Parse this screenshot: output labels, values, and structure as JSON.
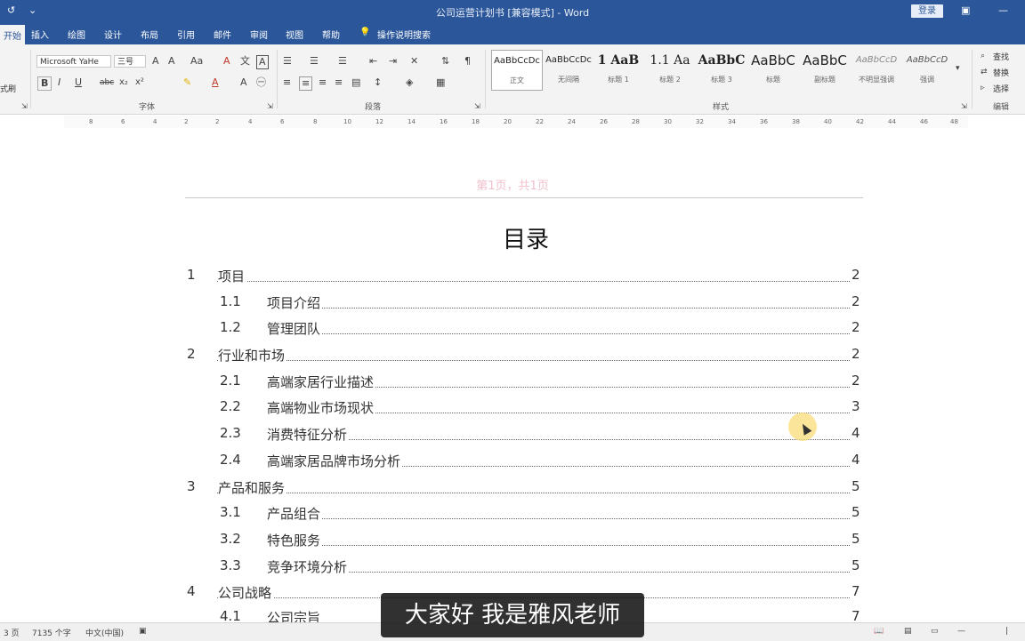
{
  "window": {
    "title": "公司运营计划书 [兼容模式]  -  Word",
    "login": "登录",
    "ribbon_display_icon": "ribbon-display-icon",
    "minimize_icon": "minimize-icon"
  },
  "tabs": [
    "开始",
    "插入",
    "绘图",
    "设计",
    "布局",
    "引用",
    "邮件",
    "审阅",
    "视图",
    "帮助"
  ],
  "tell_me": "操作说明搜索",
  "ribbon": {
    "clipboard": {
      "format_painter": "式刷"
    },
    "font": {
      "font_name": "Microsoft YaHe",
      "font_size": "三号",
      "group_label": "字体",
      "bold": "B",
      "italic": "I",
      "underline": "U",
      "strike": "abc",
      "subscript": "x₂",
      "superscript": "x²",
      "grow": "A",
      "shrink": "A",
      "case": "Aa",
      "clear": "A",
      "phonetic": "文",
      "border": "A"
    },
    "paragraph": {
      "group_label": "段落"
    },
    "styles": {
      "group_label": "样式",
      "items": [
        {
          "sample": "AaBbCcDc",
          "name": "正文"
        },
        {
          "sample": "AaBbCcDc",
          "name": "无间隔"
        },
        {
          "sample": "1  AaB",
          "name": "标题 1"
        },
        {
          "sample": "1.1  Aa",
          "name": "标题 2"
        },
        {
          "sample": "AaBbC",
          "name": "标题 3"
        },
        {
          "sample": "AaBbC",
          "name": "标题"
        },
        {
          "sample": "AaBbC",
          "name": "副标题"
        },
        {
          "sample": "AaBbCcD",
          "name": "不明显强调"
        },
        {
          "sample": "AaBbCcD",
          "name": "强调"
        }
      ]
    },
    "editing": {
      "find": "查找",
      "replace": "替换",
      "select": "选择",
      "group_label": "编辑"
    }
  },
  "ruler_ticks": [
    "8",
    "6",
    "4",
    "2",
    "2",
    "4",
    "6",
    "8",
    "10",
    "12",
    "14",
    "16",
    "18",
    "20",
    "22",
    "24",
    "26",
    "28",
    "30",
    "32",
    "34",
    "36",
    "38",
    "40",
    "42",
    "44",
    "46",
    "48"
  ],
  "document": {
    "header": "第1页，共1页",
    "title": "目录",
    "toc": [
      {
        "num": "1",
        "label": "项目",
        "page": "2",
        "level": 1
      },
      {
        "num": "1.1",
        "label": "项目介绍",
        "page": "2",
        "level": 2
      },
      {
        "num": "1.2",
        "label": "管理团队",
        "page": "2",
        "level": 2
      },
      {
        "num": "2",
        "label": "行业和市场",
        "page": "2",
        "level": 1
      },
      {
        "num": "2.1",
        "label": "高端家居行业描述",
        "page": "2",
        "level": 2
      },
      {
        "num": "2.2",
        "label": "高端物业市场现状",
        "page": "3",
        "level": 2
      },
      {
        "num": "2.3",
        "label": "消费特征分析",
        "page": "4",
        "level": 2
      },
      {
        "num": "2.4",
        "label": "高端家居品牌市场分析",
        "page": "4",
        "level": 2
      },
      {
        "num": "3",
        "label": "产品和服务",
        "page": "5",
        "level": 1
      },
      {
        "num": "3.1",
        "label": "产品组合",
        "page": "5",
        "level": 2
      },
      {
        "num": "3.2",
        "label": "特色服务",
        "page": "5",
        "level": 2
      },
      {
        "num": "3.3",
        "label": "竞争环境分析",
        "page": "5",
        "level": 2
      },
      {
        "num": "4",
        "label": "公司战略",
        "page": "7",
        "level": 1
      },
      {
        "num": "4.1",
        "label": "公司宗旨",
        "page": "7",
        "level": 2
      }
    ]
  },
  "status": {
    "page": "3 页",
    "words": "7135 个字",
    "language": "中文(中国)"
  },
  "subtitle": "大家好 我是雅风老师"
}
